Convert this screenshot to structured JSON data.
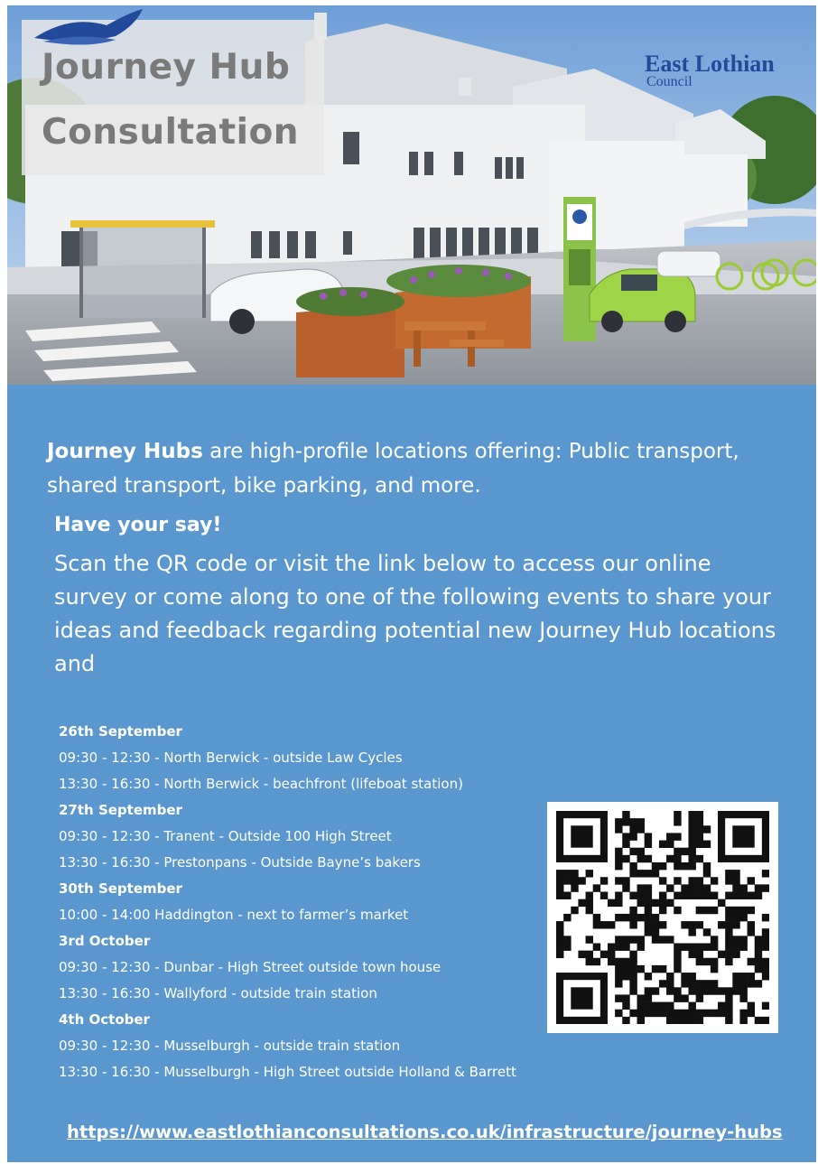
{
  "header": {
    "title_line1": "Journey Hub",
    "title_line2": "Consultation",
    "logo_line1": "East Lothian",
    "logo_line2": "Council"
  },
  "intro": {
    "bold_lead": "Journey Hubs",
    "text": " are high-profile locations offering: Public transport, shared transport, bike parking, and more."
  },
  "call_to_action": {
    "heading": "Have your say!",
    "body": "Scan  the QR code or visit the link below to access our online survey or come along to one of the following events to share your ideas and feedback regarding potential new Journey Hub locations and"
  },
  "events": [
    {
      "date": "26th September",
      "items": [
        "09:30 - 12:30 - North Berwick -  outside Law Cycles",
        "13:30 - 16:30 - North Berwick - beachfront (lifeboat station)"
      ]
    },
    {
      "date": "27th September",
      "items": [
        "09:30 - 12:30 - Tranent -  Outside 100 High Street",
        "13:30 - 16:30 - Prestonpans -  Outside Bayne’s bakers"
      ]
    },
    {
      "date": "30th September",
      "items": [
        "10:00 - 14:00 Haddington - next to farmer’s market"
      ]
    },
    {
      "date": "3rd October",
      "items": [
        "09:30 - 12:30 - Dunbar - High Street outside town house",
        "13:30 - 16:30 - Wallyford - outside train station"
      ]
    },
    {
      "date": "4th October",
      "items": [
        "09:30 - 12:30 - Musselburgh - outside train station",
        "13:30 - 16:30 - Musselburgh -  High Street outside Holland & Barrett"
      ]
    }
  ],
  "link": "https://www.eastlothianconsultations.co.uk/infrastructure/journey-hubs",
  "colors": {
    "panel_blue": "#5b97cf",
    "logo_blue": "#234a9a",
    "hub_green": "#8bc34a"
  }
}
